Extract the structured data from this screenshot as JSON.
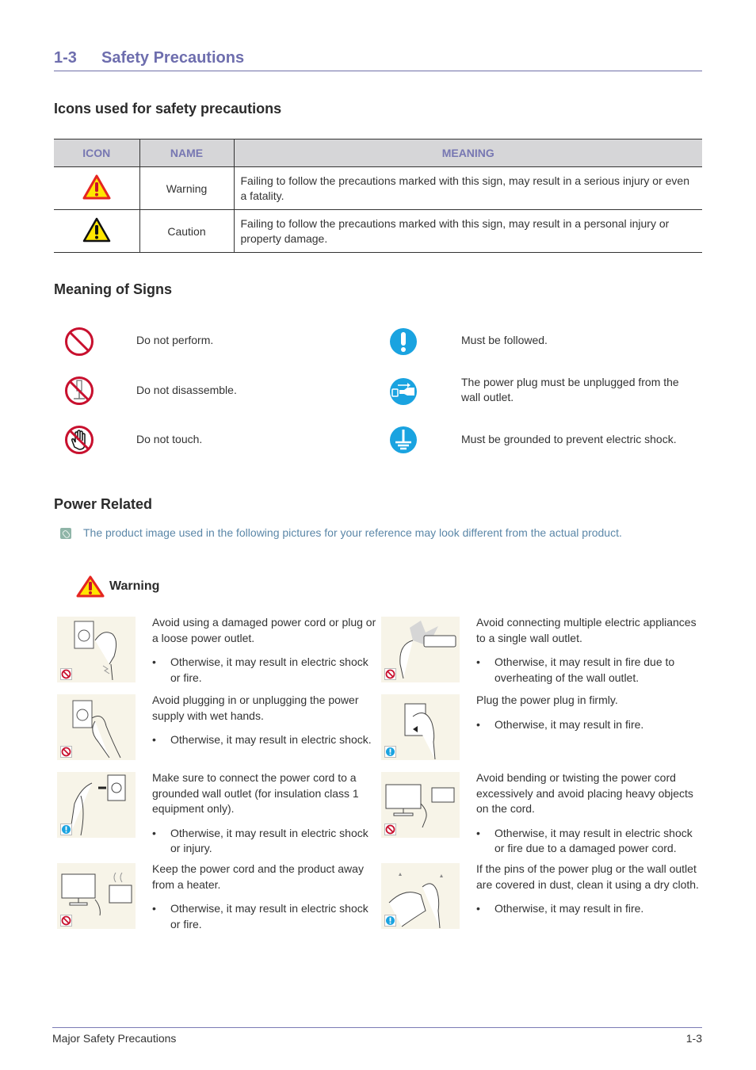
{
  "header": {
    "section_number": "1-3",
    "section_title": "Safety Precautions"
  },
  "icons_section": {
    "heading": "Icons used for safety precautions",
    "columns": [
      "ICON",
      "NAME",
      "MEANING"
    ],
    "rows": [
      {
        "icon": "warning-triangle-red-icon",
        "name": "Warning",
        "meaning": "Failing to follow the precautions marked with this sign, may result in a serious injury or even a fatality."
      },
      {
        "icon": "caution-triangle-black-icon",
        "name": "Caution",
        "meaning": "Failing to follow the precautions marked with this sign, may result in a personal injury or property damage."
      }
    ]
  },
  "signs_section": {
    "heading": "Meaning of Signs",
    "left": [
      {
        "icon": "prohibition-icon",
        "text": "Do not perform."
      },
      {
        "icon": "no-disassemble-icon",
        "text": "Do not disassemble."
      },
      {
        "icon": "no-touch-icon",
        "text": "Do not touch."
      }
    ],
    "right": [
      {
        "icon": "exclamation-icon",
        "text": "Must be followed."
      },
      {
        "icon": "unplug-icon",
        "text": "The power plug must be unplugged from the wall outlet."
      },
      {
        "icon": "ground-icon",
        "text": "Must be grounded to prevent electric shock."
      }
    ]
  },
  "power_section": {
    "heading": "Power Related",
    "note_icon": "note-pencil-icon",
    "note": "The product image used in the following pictures for your reference may look different from the actual product.",
    "warning_label": "Warning",
    "items": [
      {
        "badge": "prohibition",
        "main": "Avoid using a damaged power cord or plug or a loose power outlet.",
        "bullet": "Otherwise, it may result in electric shock or fire."
      },
      {
        "badge": "prohibition",
        "main": "Avoid connecting multiple electric appliances to a single wall outlet.",
        "bullet": "Otherwise, it may result in fire due to overheating of the wall outlet."
      },
      {
        "badge": "prohibition",
        "main": "Avoid plugging in or unplugging the power supply with wet hands.",
        "bullet": "Otherwise, it may result in electric shock."
      },
      {
        "badge": "mandatory",
        "main": "Plug the power plug in firmly.",
        "bullet": "Otherwise, it may result in fire."
      },
      {
        "badge": "mandatory",
        "main": "Make sure to connect the power cord to a grounded wall outlet (for insulation class 1 equipment only).",
        "bullet": "Otherwise, it may result in electric shock or injury."
      },
      {
        "badge": "prohibition",
        "main": "Avoid bending or twisting the power cord excessively and avoid placing heavy objects on the cord.",
        "bullet": "Otherwise, it may result in electric shock or fire due to a damaged power cord."
      },
      {
        "badge": "prohibition",
        "main": "Keep the power cord and the product away from a heater.",
        "bullet": "Otherwise, it may result in electric shock or fire."
      },
      {
        "badge": "mandatory",
        "main": "If the pins of the power plug or the wall outlet are covered in dust, clean it using a dry cloth.",
        "bullet": "Otherwise, it may result in fire."
      }
    ],
    "bullet_glyph": "•"
  },
  "footer": {
    "left": "Major Safety Precautions",
    "right": "1-3"
  },
  "colors": {
    "title_accent": "#6e6eae",
    "prohibit_red": "#c8102e",
    "mandatory_blue": "#1aa3e0",
    "note_text": "#5b87a8",
    "warning_yellow": "#ffe600"
  }
}
